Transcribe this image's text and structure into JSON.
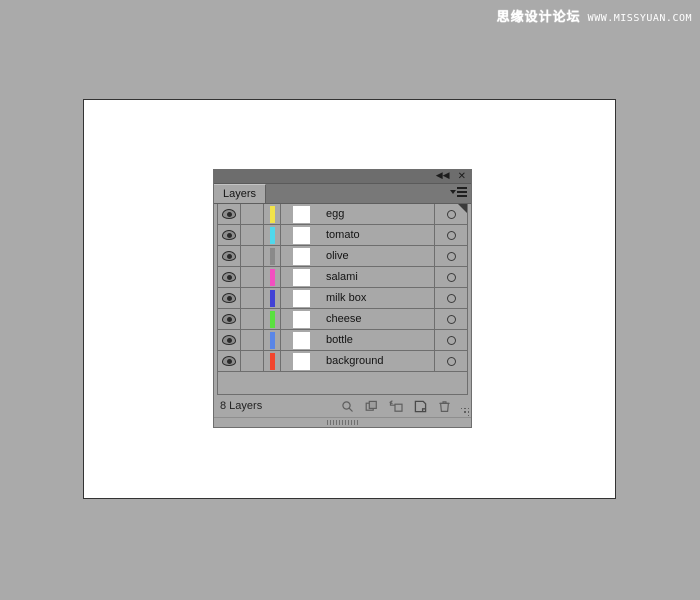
{
  "watermark": {
    "chinese": "思缘设计论坛",
    "url": "WWW.MISSYUAN.COM"
  },
  "panel": {
    "tab_label": "Layers",
    "collapse_icon": "◀◀",
    "close_icon": "✕",
    "menu_icon": "panel-menu",
    "status_text": "8 Layers",
    "layers": [
      {
        "name": "egg",
        "color": "#f2e34a",
        "visible": true,
        "locked": false,
        "target": false
      },
      {
        "name": "tomato",
        "color": "#4fd8ec",
        "visible": true,
        "locked": false,
        "target": false
      },
      {
        "name": "olive",
        "color": "#8a8a8a",
        "visible": true,
        "locked": false,
        "target": false
      },
      {
        "name": "salami",
        "color": "#f24fc0",
        "visible": true,
        "locked": false,
        "target": false
      },
      {
        "name": "milk box",
        "color": "#4141d6",
        "visible": true,
        "locked": false,
        "target": false
      },
      {
        "name": "cheese",
        "color": "#5ae040",
        "visible": true,
        "locked": false,
        "target": false
      },
      {
        "name": "bottle",
        "color": "#5a86e8",
        "visible": true,
        "locked": false,
        "target": false
      },
      {
        "name": "background",
        "color": "#f2452e",
        "visible": true,
        "locked": false,
        "target": false
      }
    ],
    "tools": [
      {
        "name": "locate-object-icon",
        "title": "Locate Object"
      },
      {
        "name": "make-sublayer-icon",
        "title": "Make/Release Clipping Mask"
      },
      {
        "name": "create-new-sublayer-icon",
        "title": "Create New Sublayer"
      },
      {
        "name": "create-new-layer-icon",
        "title": "Create New Layer"
      },
      {
        "name": "delete-layer-icon",
        "title": "Delete Selection"
      }
    ]
  },
  "theme": {
    "app_background": "#aaaaaa",
    "canvas_background": "#ffffff",
    "panel_background": "#a8a8a8",
    "panel_titlebar": "#6d6d6d",
    "panel_tabstrip": "#787878",
    "border": "#6e6e6e",
    "text": "#131313"
  }
}
